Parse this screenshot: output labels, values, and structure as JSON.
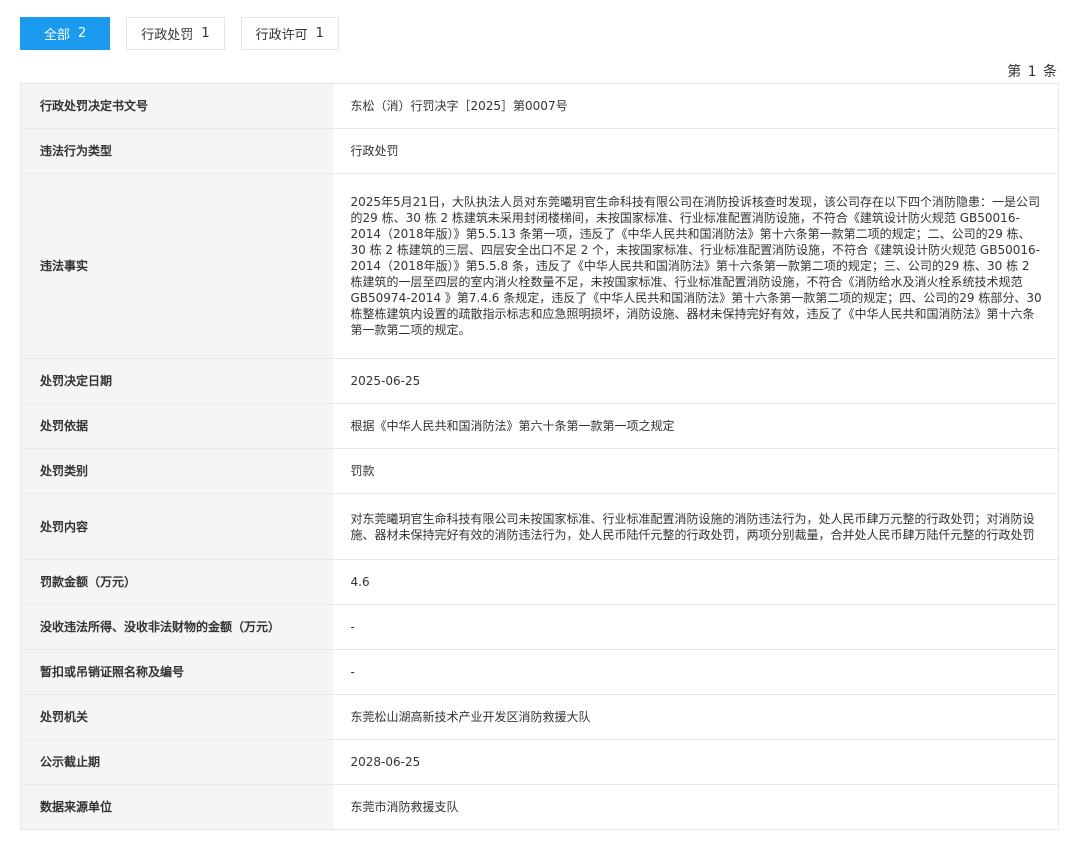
{
  "tabs": [
    {
      "label": "全部",
      "count": "2",
      "active": true
    },
    {
      "label": "行政处罚",
      "count": "1",
      "active": false
    },
    {
      "label": "行政许可",
      "count": "1",
      "active": false
    }
  ],
  "page_count": "第 1 条",
  "rows": [
    {
      "label": "行政处罚决定书文号",
      "value": "东松（消）行罚决字［2025］第0007号"
    },
    {
      "label": "违法行为类型",
      "value": "行政处罚"
    },
    {
      "label": "违法事实",
      "value": "2025年5月21日，大队执法人员对东莞曦玥官生命科技有限公司在消防投诉核查时发现，该公司存在以下四个消防隐患：一是公司的29 栋、30 栋 2 栋建筑未采用封闭楼梯间，未按国家标准、行业标准配置消防设施，不符合《建筑设计防火规范 GB50016-2014（2018年版）》第5.5.13 条第一项，违反了《中华人民共和国消防法》第十六条第一款第二项的规定；二、公司的29 栋、30 栋 2 栋建筑的三层、四层安全出口不足 2 个，未按国家标准、行业标准配置消防设施，不符合《建筑设计防火规范 GB50016-2014（2018年版）》第5.5.8 条，违反了《中华人民共和国消防法》第十六条第一款第二项的规定；三、公司的29 栋、30 栋 2 栋建筑的一层至四层的室内消火栓数量不足，未按国家标准、行业标准配置消防设施，不符合《消防给水及消火栓系统技术规范 GB50974-2014 》第7.4.6 条规定，违反了《中华人民共和国消防法》第十六条第一款第二项的规定；四、公司的29 栋部分、30 栋整栋建筑内设置的疏散指示标志和应急照明损坏，消防设施、器材未保持完好有效，违反了《中华人民共和国消防法》第十六条第一款第二项的规定。"
    },
    {
      "label": "处罚决定日期",
      "value": "2025-06-25"
    },
    {
      "label": "处罚依据",
      "value": "根据《中华人民共和国消防法》第六十条第一款第一项之规定"
    },
    {
      "label": "处罚类别",
      "value": "罚款"
    },
    {
      "label": "处罚内容",
      "value": "对东莞曦玥官生命科技有限公司未按国家标准、行业标准配置消防设施的消防违法行为，处人民币肆万元整的行政处罚；对消防设施、器材未保持完好有效的消防违法行为，处人民币陆仟元整的行政处罚，两项分别裁量，合并处人民币肆万陆仟元整的行政处罚"
    },
    {
      "label": "罚款金额（万元）",
      "value": "4.6"
    },
    {
      "label": "没收违法所得、没收非法财物的金额（万元）",
      "value": "-"
    },
    {
      "label": "暂扣或吊销证照名称及编号",
      "value": "-"
    },
    {
      "label": "处罚机关",
      "value": "东莞松山湖高新技术产业开发区消防救援大队"
    },
    {
      "label": "公示截止期",
      "value": "2028-06-25"
    },
    {
      "label": "数据来源单位",
      "value": "东莞市消防救援支队"
    }
  ]
}
